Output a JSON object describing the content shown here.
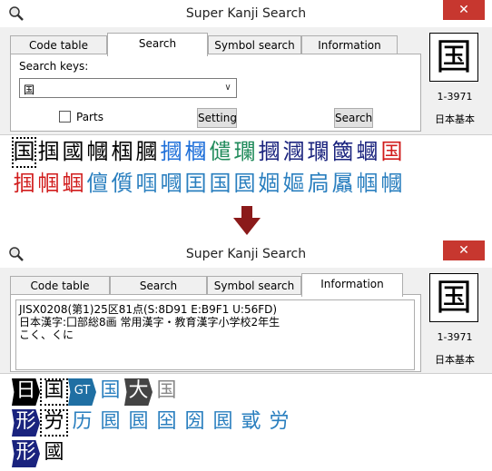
{
  "window": {
    "title": "Super Kanji Search",
    "close_glyph": "✕",
    "icon": "magnifier-app-icon"
  },
  "tabs_top": [
    "Code table",
    "Search",
    "Symbol search",
    "Information"
  ],
  "tabs_bottom": [
    "Code table",
    "Search",
    "Symbol search",
    "Information"
  ],
  "search_panel": {
    "label": "Search keys:",
    "value": "国",
    "dropdown_glyph": "∨",
    "checkbox_label": "Parts",
    "setting_button": "Setting",
    "search_button": "Search"
  },
  "selected": {
    "kanji": "国",
    "code": "1-3971",
    "category": "日本基本"
  },
  "result_rows": [
    [
      {
        "ch": "国",
        "color": "#000000",
        "sel": true
      },
      {
        "ch": "掴",
        "color": "#000000"
      },
      {
        "ch": "國",
        "color": "#000000"
      },
      {
        "ch": "幗",
        "color": "#000000"
      },
      {
        "ch": "椢",
        "color": "#000000"
      },
      {
        "ch": "膕",
        "color": "#000000"
      },
      {
        "ch": "摑",
        "color": "#1e6fd9"
      },
      {
        "ch": "槶",
        "color": "#1e6fd9"
      },
      {
        "ch": "儙",
        "color": "#1f8a5a"
      },
      {
        "ch": "瓓",
        "color": "#1f8a5a"
      },
      {
        "ch": "摑",
        "color": "#1a237e"
      },
      {
        "ch": "漍",
        "color": "#1a237e"
      },
      {
        "ch": "瓓",
        "color": "#1a237e"
      },
      {
        "ch": "簂",
        "color": "#1a237e"
      },
      {
        "ch": "蟈",
        "color": "#1a237e"
      },
      {
        "ch": "国",
        "color": "#d11c1c"
      }
    ],
    [
      {
        "ch": "掴",
        "color": "#d11c1c"
      },
      {
        "ch": "帼",
        "color": "#d11c1c"
      },
      {
        "ch": "蝈",
        "color": "#d11c1c"
      },
      {
        "ch": "儃",
        "color": "#2a7fbf"
      },
      {
        "ch": "儨",
        "color": "#2a7fbf"
      },
      {
        "ch": "啯",
        "color": "#2a7fbf"
      },
      {
        "ch": "嘓",
        "color": "#2a7fbf"
      },
      {
        "ch": "囯",
        "color": "#2a7fbf"
      },
      {
        "ch": "国",
        "color": "#2a7fbf"
      },
      {
        "ch": "囻",
        "color": "#2a7fbf"
      },
      {
        "ch": "婟",
        "color": "#2a7fbf"
      },
      {
        "ch": "嫗",
        "color": "#2a7fbf"
      },
      {
        "ch": "扃",
        "color": "#2a7fbf"
      },
      {
        "ch": "屭",
        "color": "#2a7fbf"
      },
      {
        "ch": "帼",
        "color": "#2a7fbf"
      },
      {
        "ch": "幗",
        "color": "#2a7fbf"
      }
    ]
  ],
  "info_text": {
    "line1": "JISX0208(第1)25区81点(S:8D91  E:B9F1  U:56FD)",
    "line2": "日本漢字:囗部総8画 常用漢字・教育漢字小学校2年生",
    "line3": "こく、くに"
  },
  "info_rows": [
    [
      {
        "ch": "日",
        "style": "badge black"
      },
      {
        "ch": "国",
        "style": "sel"
      },
      {
        "ch": "GT",
        "style": "badge teal"
      },
      {
        "ch": "国",
        "color": "#2a7fbf"
      },
      {
        "ch": "大",
        "style": "badge dgray"
      },
      {
        "ch": "国",
        "color": "#888888"
      }
    ],
    [
      {
        "ch": "形",
        "style": "badge navy"
      },
      {
        "ch": "労",
        "style": "sel"
      },
      {
        "ch": "历",
        "color": "#2a7fbf"
      },
      {
        "ch": "囻",
        "color": "#2a7fbf"
      },
      {
        "ch": "囻",
        "color": "#2a7fbf"
      },
      {
        "ch": "囶",
        "color": "#2a7fbf"
      },
      {
        "ch": "圀",
        "color": "#2a7fbf"
      },
      {
        "ch": "囻",
        "color": "#2a7fbf"
      },
      {
        "ch": "戜",
        "color": "#2a7fbf"
      },
      {
        "ch": "労",
        "color": "#2a7fbf"
      }
    ],
    [
      {
        "ch": "形",
        "style": "badge navy"
      },
      {
        "ch": "國",
        "color": "#000000"
      }
    ]
  ],
  "colors": {
    "close": "#c7372f",
    "arrow": "#8b1a1a"
  }
}
